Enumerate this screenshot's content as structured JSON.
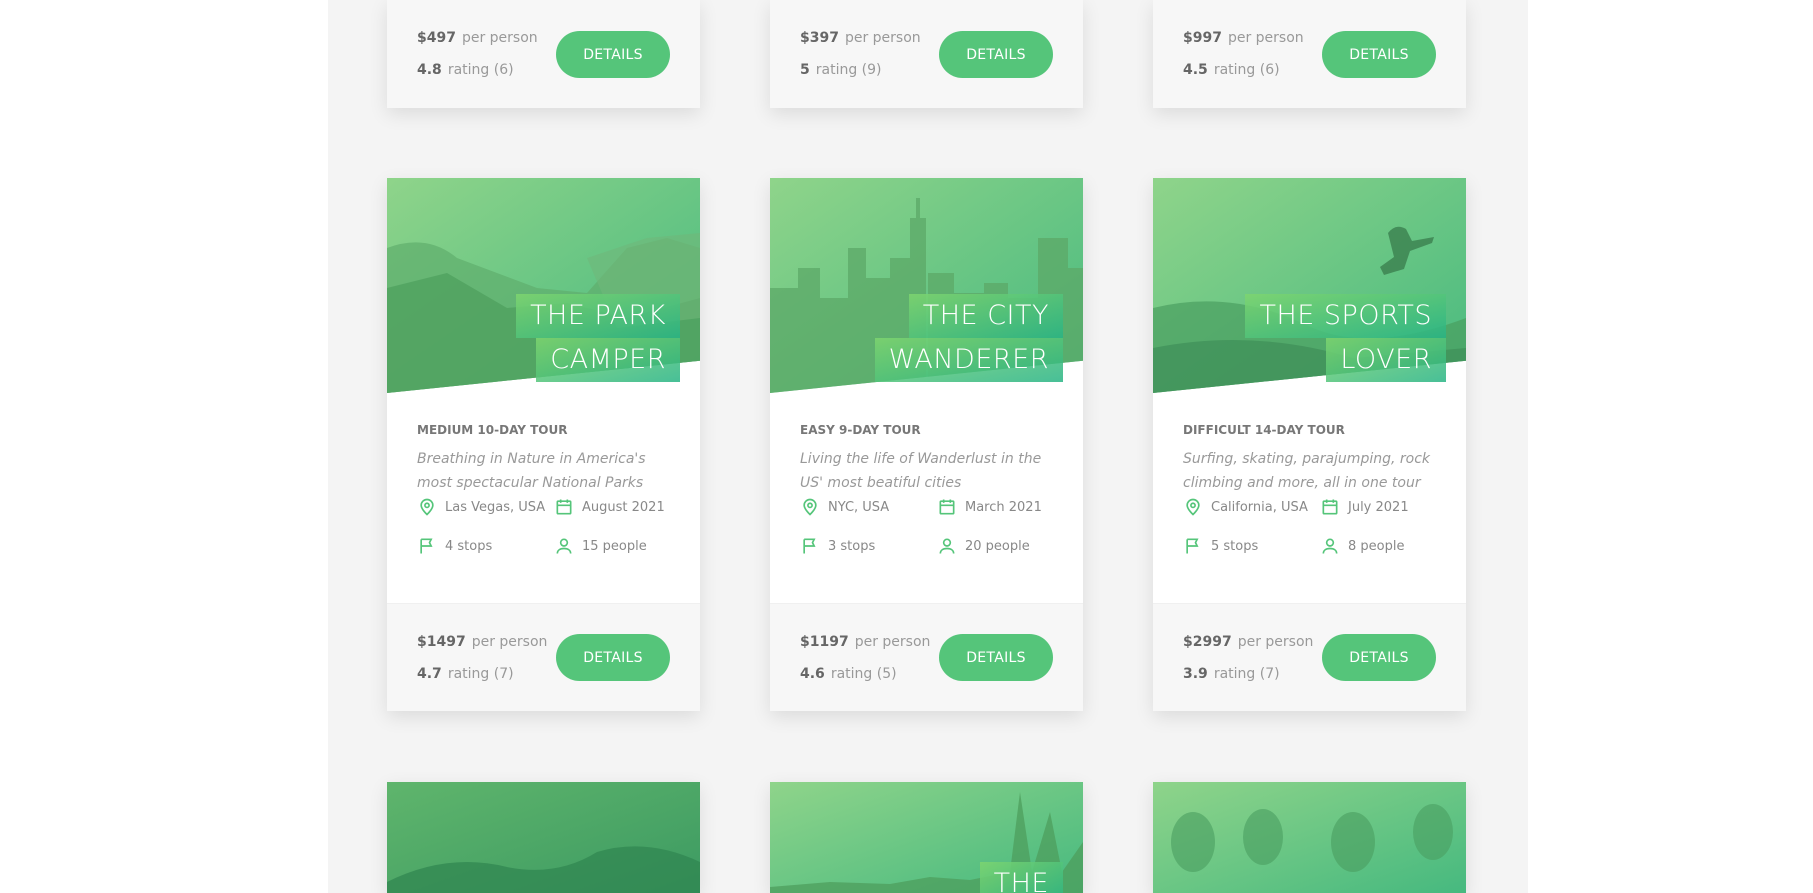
{
  "colors": {
    "brand": "#55c57a",
    "brand_light": "#7ed56f",
    "brand_dark": "#28b485"
  },
  "tours_top_row": [
    {
      "price": "$497",
      "price_suffix": "per person",
      "rating": "4.8",
      "rating_suffix": "rating (6)",
      "button": "DETAILS"
    },
    {
      "price": "$397",
      "price_suffix": "per person",
      "rating": "5",
      "rating_suffix": "rating (9)",
      "button": "DETAILS"
    },
    {
      "price": "$997",
      "price_suffix": "per person",
      "rating": "4.5",
      "rating_suffix": "rating (6)",
      "button": "DETAILS"
    }
  ],
  "tours": [
    {
      "title_line1": "THE PARK",
      "title_line2": "CAMPER",
      "subheading": "MEDIUM 10-DAY TOUR",
      "summary": "Breathing in Nature in America's most spectacular National Parks",
      "location": "Las Vegas, USA",
      "date": "August 2021",
      "stops": "4 stops",
      "people": "15 people",
      "price": "$1497",
      "price_suffix": "per person",
      "rating": "4.7",
      "rating_suffix": "rating (7)",
      "button": "DETAILS"
    },
    {
      "title_line1": "THE CITY",
      "title_line2": "WANDERER",
      "subheading": "EASY 9-DAY TOUR",
      "summary": "Living the life of Wanderlust in the US' most beatiful cities",
      "location": "NYC, USA",
      "date": "March 2021",
      "stops": "3 stops",
      "people": "20 people",
      "price": "$1197",
      "price_suffix": "per person",
      "rating": "4.6",
      "rating_suffix": "rating (5)",
      "button": "DETAILS"
    },
    {
      "title_line1": "THE SPORTS",
      "title_line2": "LOVER",
      "subheading": "DIFFICULT 14-DAY TOUR",
      "summary": "Surfing, skating, parajumping, rock climbing and more, all in one tour",
      "location": "California, USA",
      "date": "July 2021",
      "stops": "5 stops",
      "people": "8 people",
      "price": "$2997",
      "price_suffix": "per person",
      "rating": "3.9",
      "rating_suffix": "rating (7)",
      "button": "DETAILS"
    }
  ],
  "tours_bottom_row": [
    {
      "title_line1": ""
    },
    {
      "title_line1": "THE"
    },
    {
      "title_line1": ""
    }
  ],
  "icons": [
    "map-pin-icon",
    "calendar-icon",
    "flag-icon",
    "user-icon"
  ]
}
